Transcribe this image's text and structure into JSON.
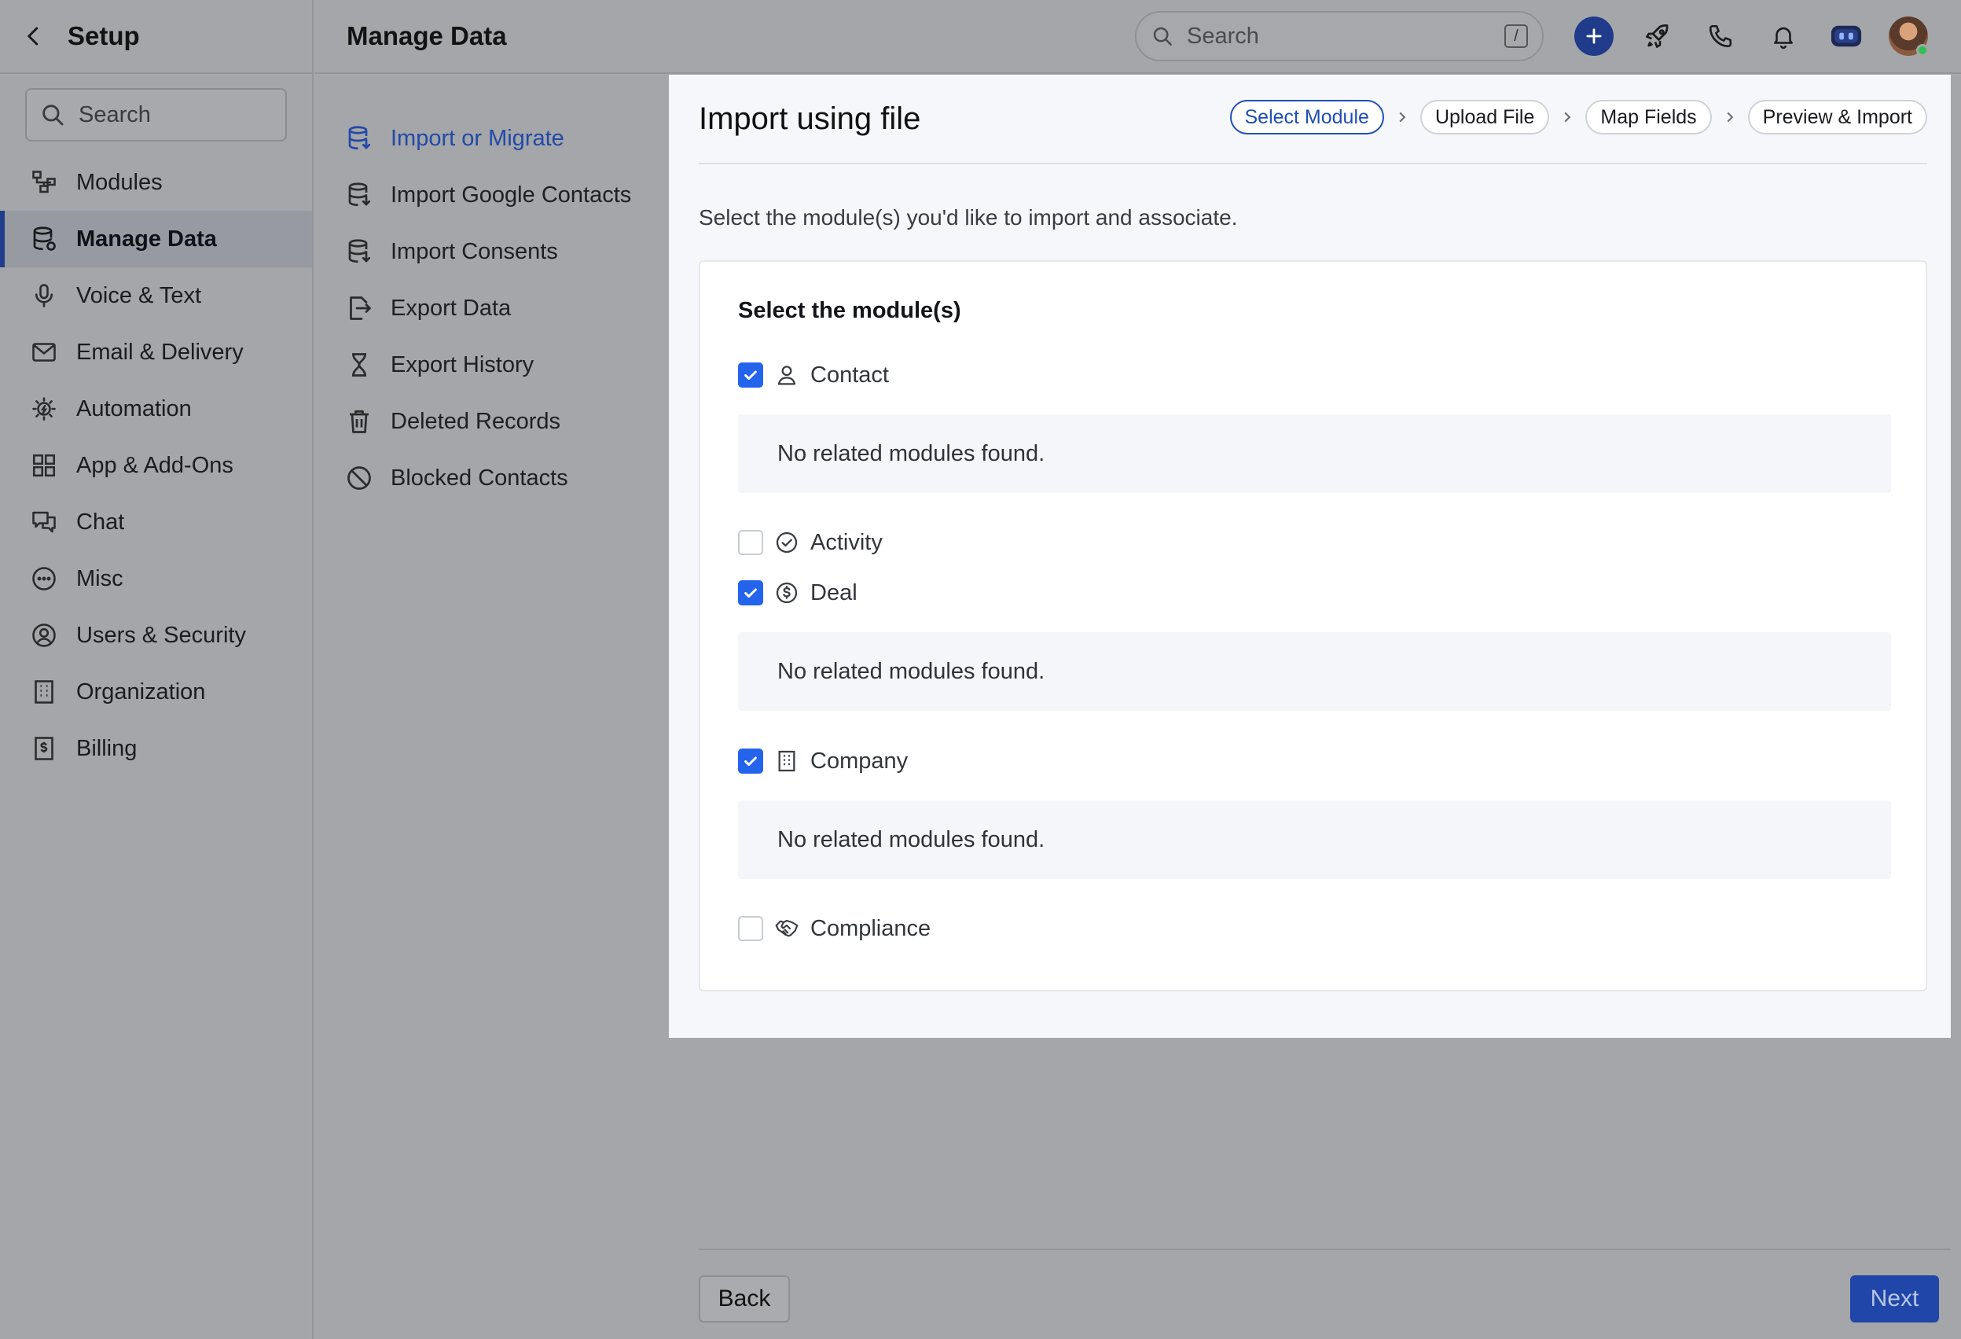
{
  "sidebar": {
    "title": "Setup",
    "search_placeholder": "Search",
    "items": [
      {
        "label": "Modules"
      },
      {
        "label": "Manage Data"
      },
      {
        "label": "Voice & Text"
      },
      {
        "label": "Email & Delivery"
      },
      {
        "label": "Automation"
      },
      {
        "label": "App & Add-Ons"
      },
      {
        "label": "Chat"
      },
      {
        "label": "Misc"
      },
      {
        "label": "Users & Security"
      },
      {
        "label": "Organization"
      },
      {
        "label": "Billing"
      }
    ],
    "active_index": 1
  },
  "header": {
    "title": "Manage Data",
    "search_placeholder": "Search",
    "search_shortcut": "/"
  },
  "submenu": {
    "items": [
      {
        "label": "Import or Migrate"
      },
      {
        "label": "Import Google Contacts"
      },
      {
        "label": "Import Consents"
      },
      {
        "label": "Export Data"
      },
      {
        "label": "Export History"
      },
      {
        "label": "Deleted Records"
      },
      {
        "label": "Blocked Contacts"
      }
    ],
    "active_index": 0
  },
  "modal": {
    "title": "Import using file",
    "steps": [
      "Select Module",
      "Upload File",
      "Map Fields",
      "Preview & Import"
    ],
    "active_step": 0,
    "description": "Select the module(s) you'd like to import and associate.",
    "card_title": "Select the module(s)",
    "modules": [
      {
        "label": "Contact",
        "checked": true,
        "related": "No related modules found."
      },
      {
        "label": "Activity",
        "checked": false
      },
      {
        "label": "Deal",
        "checked": true,
        "related": "No related modules found."
      },
      {
        "label": "Company",
        "checked": true,
        "related": "No related modules found."
      },
      {
        "label": "Compliance",
        "checked": false
      }
    ]
  },
  "footer": {
    "back_label": "Back",
    "next_label": "Next"
  },
  "colors": {
    "accent": "#2463eb",
    "primary_button": "#1f46a8",
    "overlay": "#a4a6a9"
  }
}
